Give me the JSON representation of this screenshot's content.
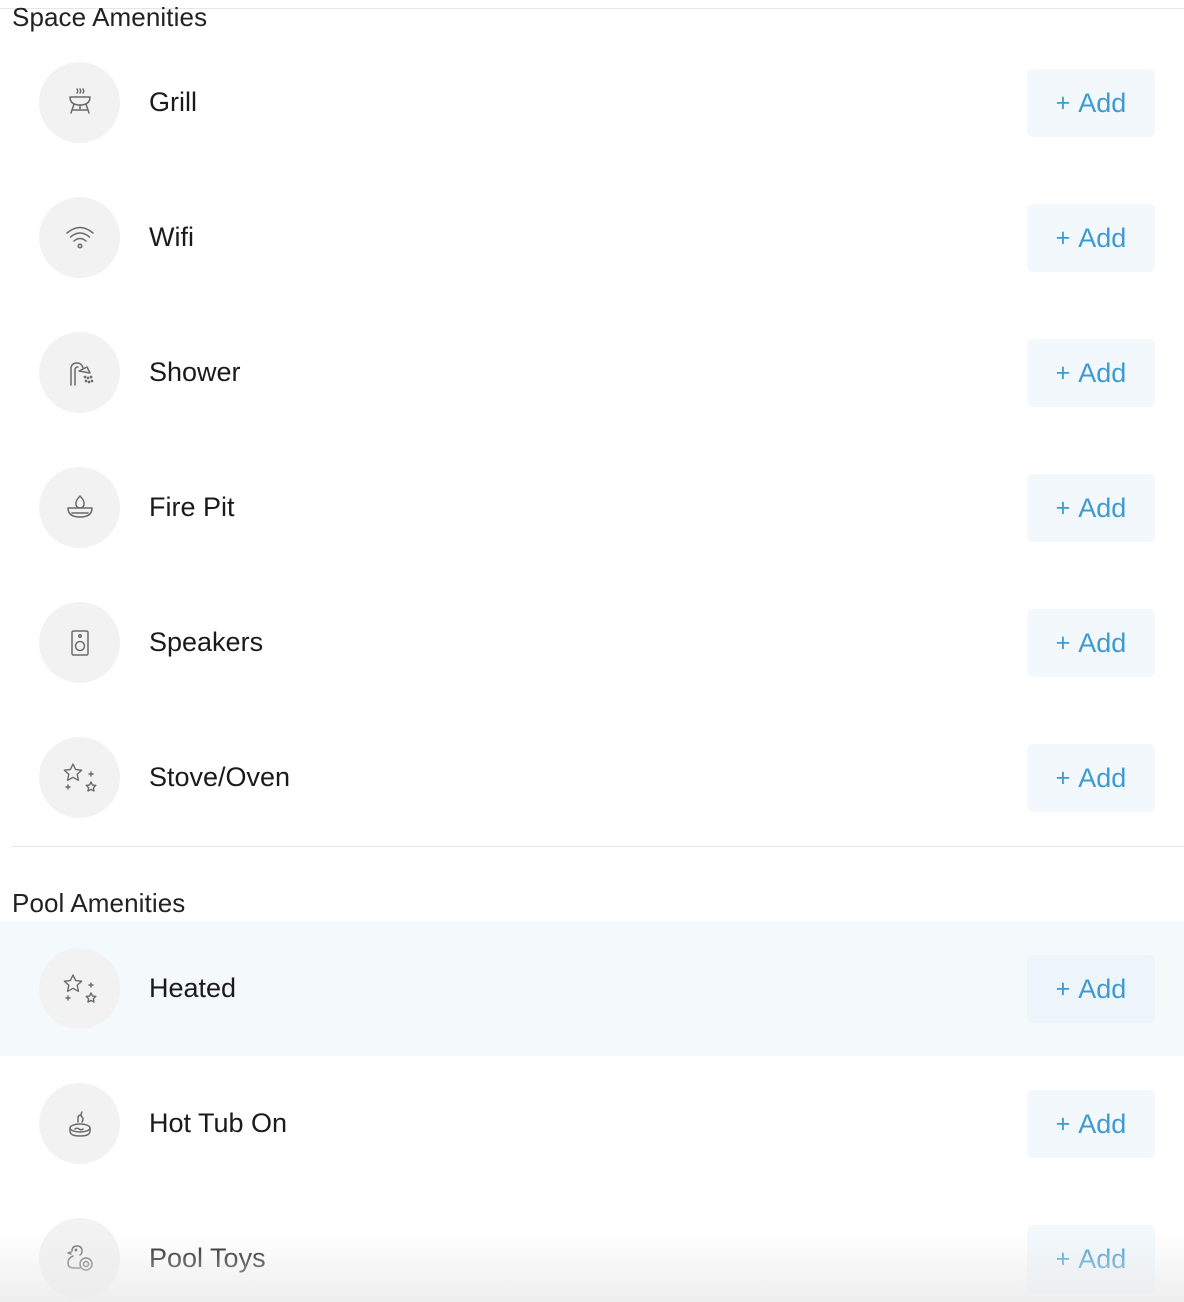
{
  "space_section": {
    "title": "Space Amenities",
    "items": [
      {
        "label": "Grill",
        "icon": "grill-icon",
        "button": "Add"
      },
      {
        "label": "Wifi",
        "icon": "wifi-icon",
        "button": "Add"
      },
      {
        "label": "Shower",
        "icon": "shower-icon",
        "button": "Add"
      },
      {
        "label": "Fire Pit",
        "icon": "fire-pit-icon",
        "button": "Add"
      },
      {
        "label": "Speakers",
        "icon": "speaker-icon",
        "button": "Add"
      },
      {
        "label": "Stove/Oven",
        "icon": "stars-icon",
        "button": "Add"
      }
    ]
  },
  "pool_section": {
    "title": "Pool Amenities",
    "items": [
      {
        "label": "Heated",
        "icon": "stars-icon",
        "button": "Add"
      },
      {
        "label": "Hot Tub On",
        "icon": "hot-tub-icon",
        "button": "Add"
      },
      {
        "label": "Pool Toys",
        "icon": "rubber-duck-icon",
        "button": "Add"
      }
    ]
  },
  "plus_symbol": "+",
  "colors": {
    "accent": "#3d9bd0",
    "button_bg": "#f2f8fc",
    "icon_circle": "#f2f2f2",
    "row_highlight": "#f4f9fc",
    "icon_stroke": "#6b6b6b"
  }
}
